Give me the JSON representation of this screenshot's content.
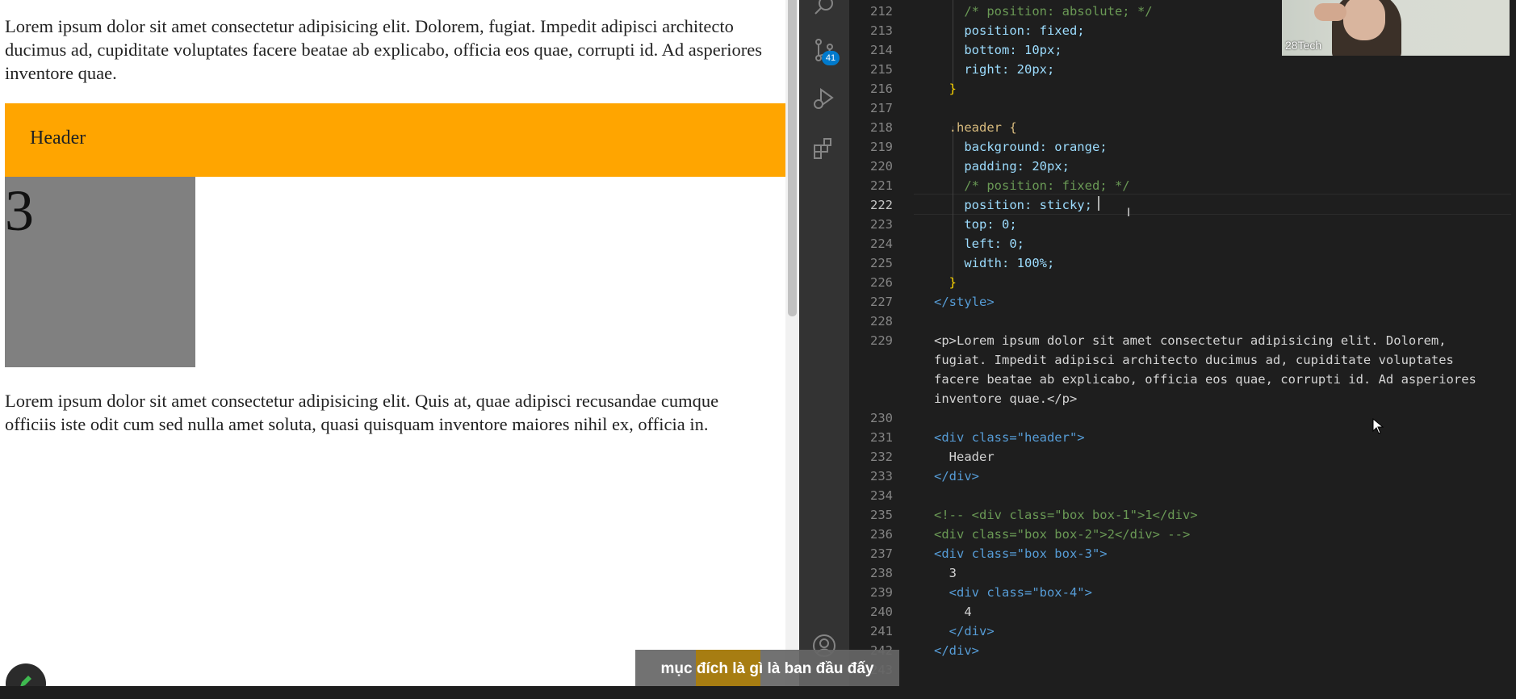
{
  "preview": {
    "para1": "Lorem ipsum dolor sit amet consectetur adipisicing elit. Dolorem, fugiat. Impedit adipisci architecto ducimus ad, cupiditate voluptates facere beatae ab explicabo, officia eos quae, corrupti id. Ad asperiores inventore quae.",
    "header_text": "Header",
    "box3_text": "3",
    "para2": "Lorem ipsum dolor sit amet consectetur adipisicing elit. Quis at, quae adipisci recusandae cumque officiis iste odit cum sed nulla amet soluta, quasi quisquam inventore maiores nihil ex, officia in.",
    "header_color": "#ffa500",
    "box_color": "#808080"
  },
  "activity_bar": {
    "items": [
      "search-icon",
      "source-control-icon",
      "run-debug-icon",
      "extensions-icon",
      "account-icon"
    ],
    "scm_badge": "41"
  },
  "editor": {
    "current_line": "222",
    "lines": [
      {
        "n": "212",
        "t": "    /* position: absolute; */"
      },
      {
        "n": "213",
        "t": "    position: fixed;"
      },
      {
        "n": "214",
        "t": "    bottom: 10px;"
      },
      {
        "n": "215",
        "t": "    right: 20px;"
      },
      {
        "n": "216",
        "t": "  }"
      },
      {
        "n": "217",
        "t": ""
      },
      {
        "n": "218",
        "t": "  .header {"
      },
      {
        "n": "219",
        "t": "    background: orange;"
      },
      {
        "n": "220",
        "t": "    padding: 20px;"
      },
      {
        "n": "221",
        "t": "    /* position: fixed; */"
      },
      {
        "n": "222",
        "t": "    position: sticky;"
      },
      {
        "n": "223",
        "t": "    top: 0;"
      },
      {
        "n": "224",
        "t": "    left: 0;"
      },
      {
        "n": "225",
        "t": "    width: 100%;"
      },
      {
        "n": "226",
        "t": "  }"
      },
      {
        "n": "227",
        "t": "</style>"
      },
      {
        "n": "228",
        "t": ""
      },
      {
        "n": "229",
        "t": "<p>Lorem ipsum dolor sit amet consectetur adipisicing elit. Dolorem, fugiat. Impedit adipisci architecto ducimus ad, cupiditate voluptates facere beatae ab explicabo, officia eos quae, corrupti id. Ad asperiores inventore quae.</p>"
      },
      {
        "n": "230",
        "t": ""
      },
      {
        "n": "231",
        "t": "<div class=\"header\">"
      },
      {
        "n": "232",
        "t": "  Header"
      },
      {
        "n": "233",
        "t": "</div>"
      },
      {
        "n": "234",
        "t": ""
      },
      {
        "n": "235",
        "t": "<!-- <div class=\"box box-1\">1</div>"
      },
      {
        "n": "236",
        "t": "<div class=\"box box-2\">2</div> -->"
      },
      {
        "n": "237",
        "t": "<div class=\"box box-3\">"
      },
      {
        "n": "238",
        "t": "  3"
      },
      {
        "n": "239",
        "t": "  <div class=\"box-4\">"
      },
      {
        "n": "240",
        "t": "    4"
      },
      {
        "n": "241",
        "t": "  </div>"
      },
      {
        "n": "242",
        "t": "</div>"
      },
      {
        "n": "243",
        "t": ""
      }
    ]
  },
  "webcam": {
    "label": "28Tech"
  },
  "subtitle": "mục đích là gì là ban đầu đấy"
}
